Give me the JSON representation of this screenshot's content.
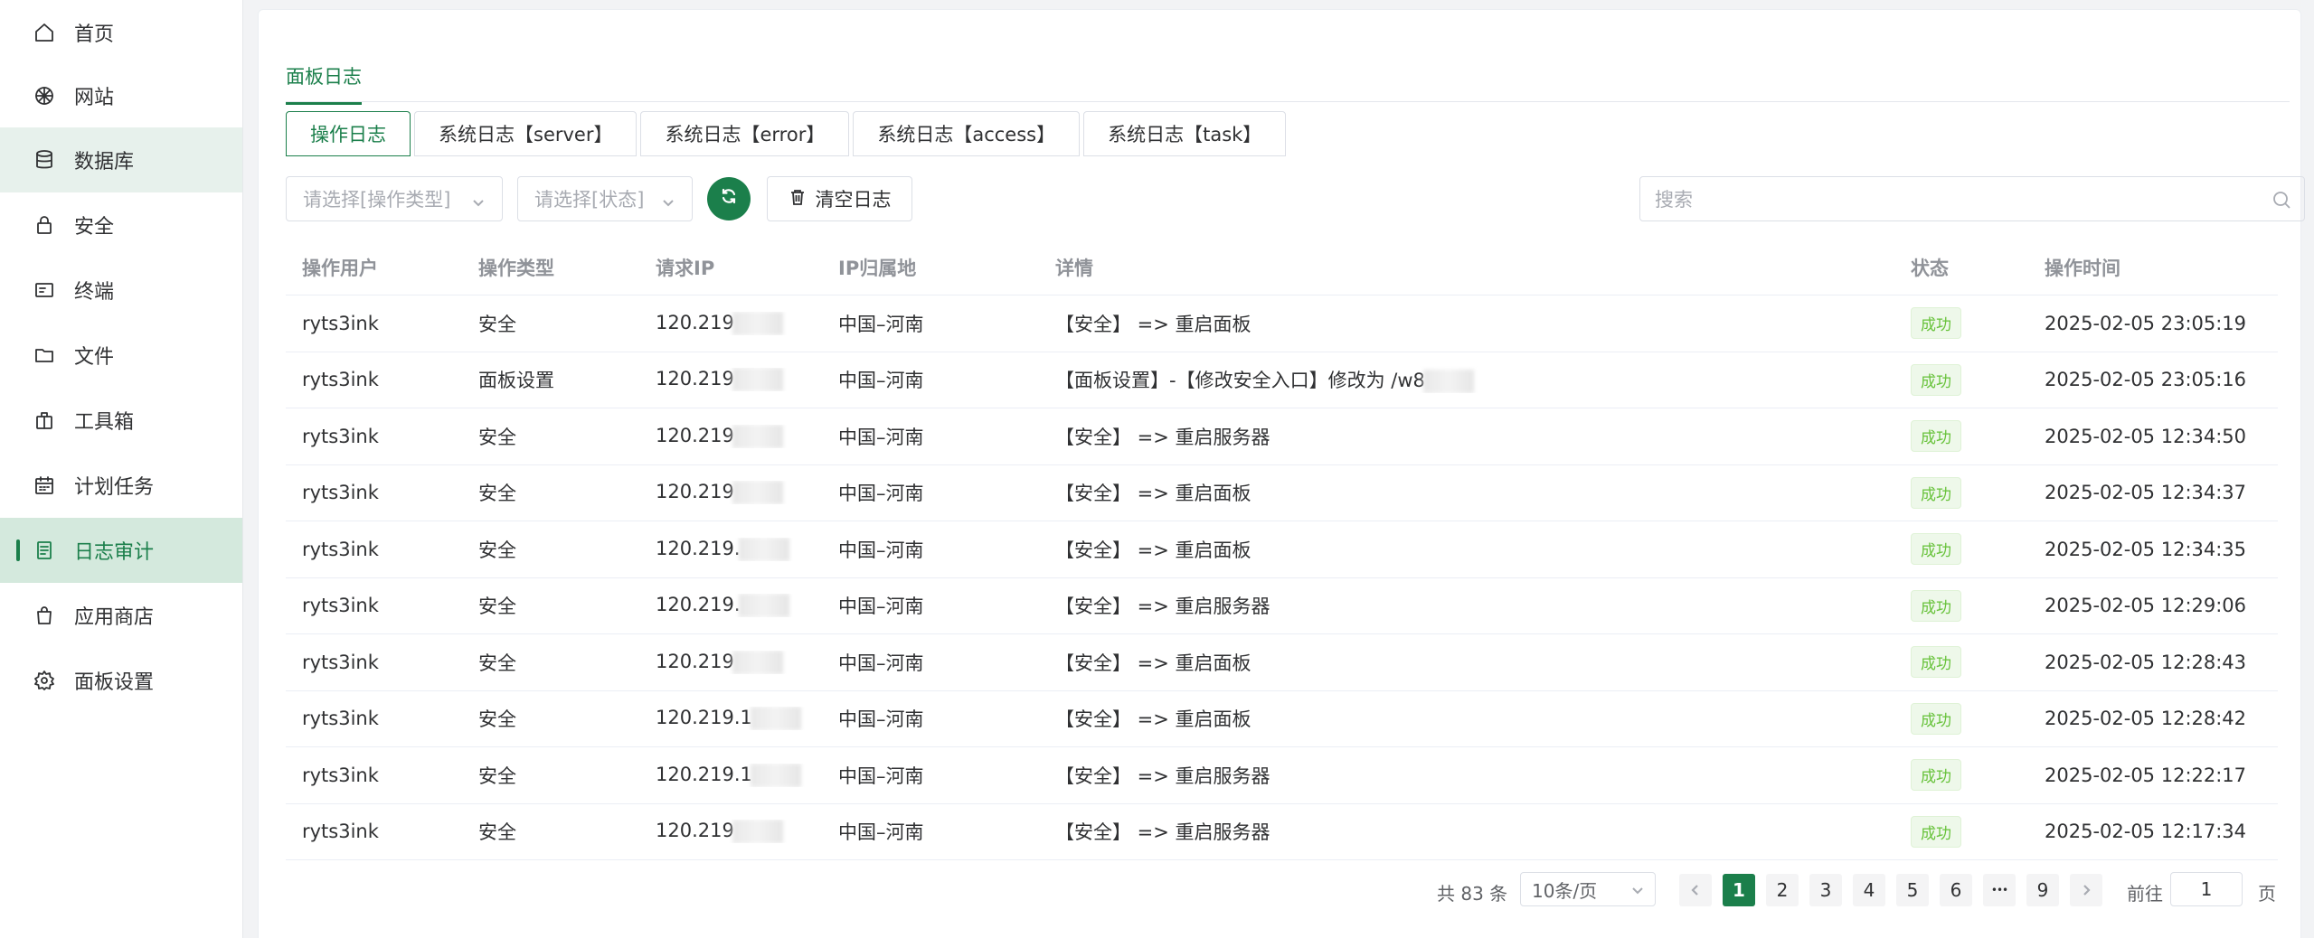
{
  "sidebar": {
    "items": [
      {
        "label": "首页",
        "icon": "home-icon"
      },
      {
        "label": "网站",
        "icon": "globe-icon"
      },
      {
        "label": "数据库",
        "icon": "database-icon"
      },
      {
        "label": "安全",
        "icon": "lock-icon"
      },
      {
        "label": "终端",
        "icon": "terminal-icon"
      },
      {
        "label": "文件",
        "icon": "folder-icon"
      },
      {
        "label": "工具箱",
        "icon": "toolbox-icon"
      },
      {
        "label": "计划任务",
        "icon": "calendar-icon"
      },
      {
        "label": "日志审计",
        "icon": "document-icon"
      },
      {
        "label": "应用商店",
        "icon": "shopping-bag-icon"
      },
      {
        "label": "面板设置",
        "icon": "gear-icon"
      }
    ]
  },
  "panel": {
    "tab": "面板日志",
    "subtabs": [
      "操作日志",
      "系统日志【server】",
      "系统日志【error】",
      "系统日志【access】",
      "系统日志【task】"
    ],
    "active_subtab": "操作日志"
  },
  "toolbar": {
    "type_placeholder": "请选择[操作类型]",
    "status_placeholder": "请选择[状态]",
    "clear_label": "清空日志",
    "search_placeholder": "搜索"
  },
  "table": {
    "headers": [
      "操作用户",
      "操作类型",
      "请求IP",
      "IP归属地",
      "详情",
      "状态",
      "操作时间"
    ],
    "rows": [
      {
        "user": "ryts3ink",
        "type": "安全",
        "ip": "120.219",
        "location": "中国–河南",
        "detail": "【安全】 => 重启面板",
        "status": "成功",
        "time": "2025-02-05 23:05:19"
      },
      {
        "user": "ryts3ink",
        "type": "面板设置",
        "ip": "120.219",
        "location": "中国–河南",
        "detail": "【面板设置】-【修改安全入口】修改为 /w8",
        "status": "成功",
        "time": "2025-02-05 23:05:16"
      },
      {
        "user": "ryts3ink",
        "type": "安全",
        "ip": "120.219",
        "location": "中国–河南",
        "detail": "【安全】 => 重启服务器",
        "status": "成功",
        "time": "2025-02-05 12:34:50"
      },
      {
        "user": "ryts3ink",
        "type": "安全",
        "ip": "120.219",
        "location": "中国–河南",
        "detail": "【安全】 => 重启面板",
        "status": "成功",
        "time": "2025-02-05 12:34:37"
      },
      {
        "user": "ryts3ink",
        "type": "安全",
        "ip": "120.219.",
        "location": "中国–河南",
        "detail": "【安全】 => 重启面板",
        "status": "成功",
        "time": "2025-02-05 12:34:35"
      },
      {
        "user": "ryts3ink",
        "type": "安全",
        "ip": "120.219.",
        "location": "中国–河南",
        "detail": "【安全】 => 重启服务器",
        "status": "成功",
        "time": "2025-02-05 12:29:06"
      },
      {
        "user": "ryts3ink",
        "type": "安全",
        "ip": "120.219",
        "location": "中国–河南",
        "detail": "【安全】 => 重启面板",
        "status": "成功",
        "time": "2025-02-05 12:28:43"
      },
      {
        "user": "ryts3ink",
        "type": "安全",
        "ip": "120.219.1",
        "location": "中国–河南",
        "detail": "【安全】 => 重启面板",
        "status": "成功",
        "time": "2025-02-05 12:28:42"
      },
      {
        "user": "ryts3ink",
        "type": "安全",
        "ip": "120.219.1",
        "location": "中国–河南",
        "detail": "【安全】 => 重启服务器",
        "status": "成功",
        "time": "2025-02-05 12:22:17"
      },
      {
        "user": "ryts3ink",
        "type": "安全",
        "ip": "120.219",
        "location": "中国–河南",
        "detail": "【安全】 => 重启服务器",
        "status": "成功",
        "time": "2025-02-05 12:17:34"
      }
    ]
  },
  "pagination": {
    "total_text": "共 83 条",
    "page_size": "10条/页",
    "pages": [
      "1",
      "2",
      "3",
      "4",
      "5",
      "6",
      "9"
    ],
    "ellipsis": "•••",
    "current": "1",
    "goto_label": "前往",
    "goto_value": "1",
    "goto_suffix": "页"
  },
  "colors": {
    "accent": "#1b7f4b",
    "success": "#67c23a"
  }
}
